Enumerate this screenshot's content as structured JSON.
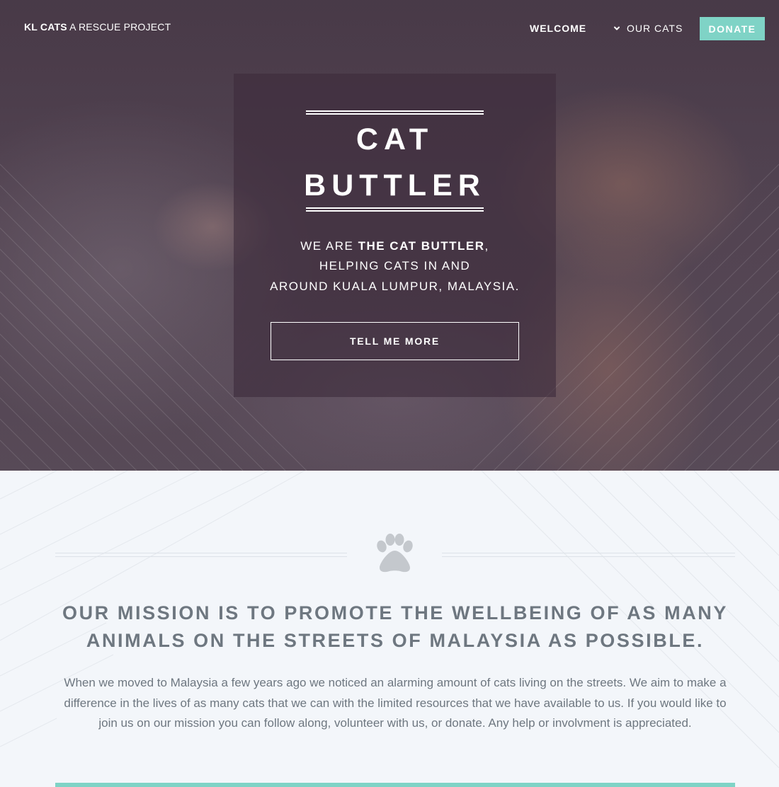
{
  "nav": {
    "brand_strong": "KL CATS",
    "brand_light": " A RESCUE PROJECT",
    "welcome": "WELCOME",
    "our_cats": "OUR CATS",
    "donate": "DONATE"
  },
  "hero": {
    "title_line1": "CAT",
    "title_line2": "BUTTLER",
    "sub_line1_pre": "WE ARE ",
    "sub_line1_strong": "THE CAT BUTTLER",
    "sub_line1_post": ",",
    "sub_line2": "HELPING CATS IN AND",
    "sub_line3": "AROUND KUALA LUMPUR, MALAYSIA.",
    "cta": "TELL ME MORE"
  },
  "mission": {
    "icon": "paw-icon",
    "heading": "OUR MISSION IS TO PROMOTE THE WELLBEING OF AS MANY ANIMALS ON THE STREETS OF MALAYSIA AS POSSIBLE.",
    "body": "When we moved to Malaysia a few years ago we noticed an alarming amount of cats living on the streets. We aim to make a difference in the lives of as many cats that we can with the limited resources that we have available to us. If you would like to join us on our mission you can follow along, volunteer with us, or donate. Any help or involvment is appreciated."
  },
  "colors": {
    "accent": "#7fd3c6",
    "hero_card": "#3e2c3c",
    "text_muted": "#6e7780",
    "section_bg": "#f3f6fa"
  }
}
